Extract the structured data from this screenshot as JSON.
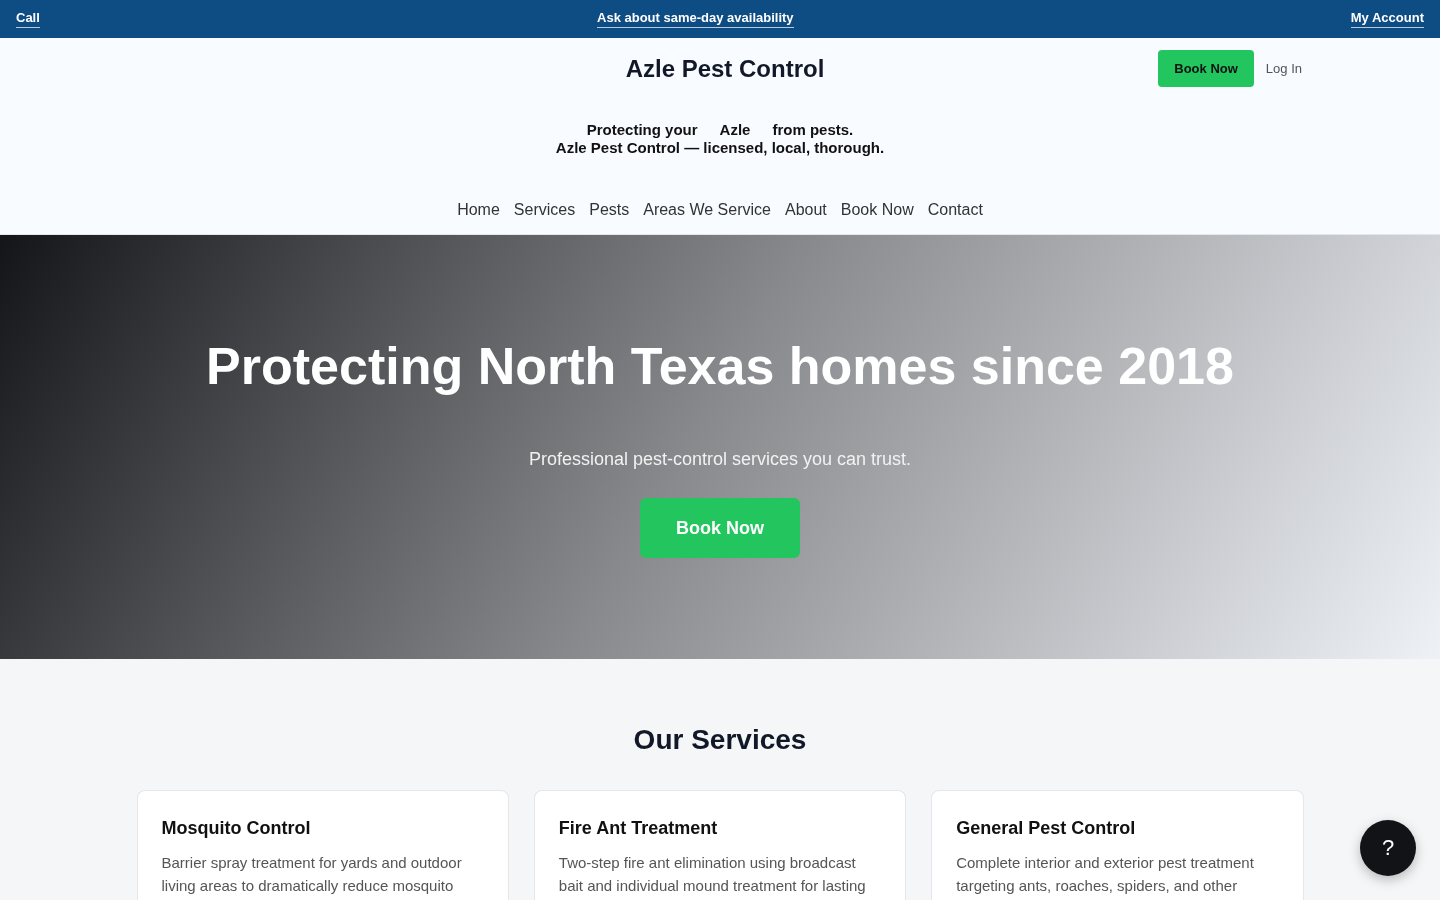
{
  "top_bar": {
    "links": [
      {
        "label": "Call"
      },
      {
        "label": "Ask about same-day availability"
      },
      {
        "label": "My Account"
      }
    ]
  },
  "header": {
    "brand": "Azle Pest Control",
    "book_button": "Book Now",
    "login_link": "Log In"
  },
  "tagline": {
    "line1_prefix": "Protecting your",
    "city": "Azle",
    "line1_suffix": "from pests.",
    "line2": "Azle Pest Control — licensed, local, thorough."
  },
  "nav": {
    "items": [
      {
        "label": "Home"
      },
      {
        "label": "Services"
      },
      {
        "label": "Pests"
      },
      {
        "label": "Areas We Service"
      },
      {
        "label": "About"
      },
      {
        "label": "Book Now"
      },
      {
        "label": "Contact"
      }
    ]
  },
  "hero": {
    "title": "Protecting North Texas homes since 2018",
    "subtitle": "Professional pest-control services you can trust.",
    "button": "Book Now"
  },
  "services": {
    "title": "Our Services",
    "cards": [
      {
        "title": "Mosquito Control",
        "description": "Barrier spray treatment for yards and outdoor living areas to dramatically reduce mosquito"
      },
      {
        "title": "Fire Ant Treatment",
        "description": "Two-step fire ant elimination using broadcast bait and individual mound treatment for lasting"
      },
      {
        "title": "General Pest Control",
        "description": "Complete interior and exterior pest treatment targeting ants, roaches, spiders, and other"
      }
    ]
  },
  "help_button": {
    "label": "?"
  }
}
